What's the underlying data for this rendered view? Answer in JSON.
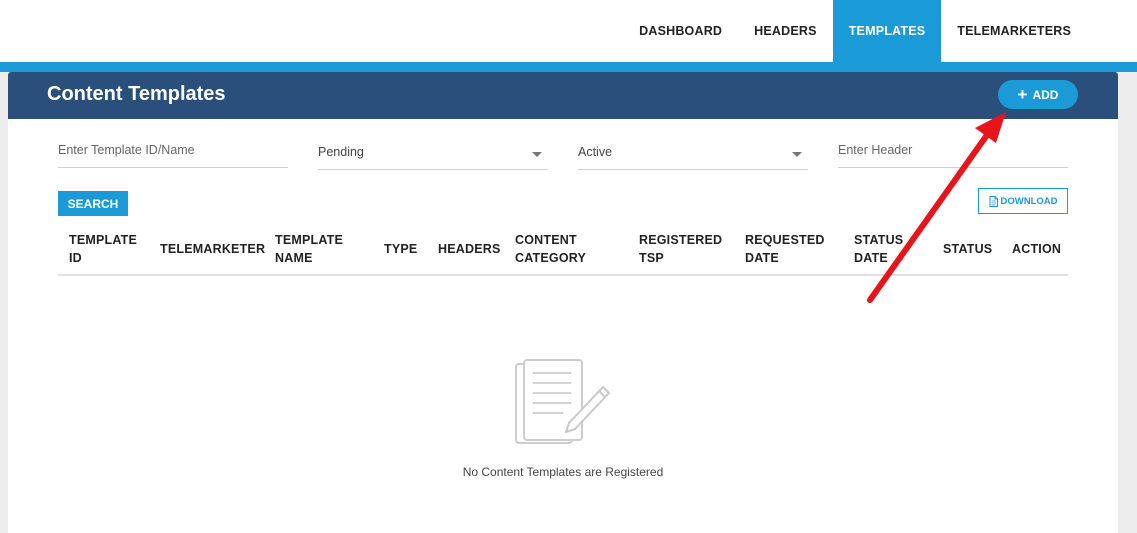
{
  "nav": {
    "items": [
      {
        "label": "DASHBOARD",
        "active": false
      },
      {
        "label": "HEADERS",
        "active": false
      },
      {
        "label": "TEMPLATES",
        "active": true
      },
      {
        "label": "TELEMARKETERS",
        "active": false
      }
    ]
  },
  "card": {
    "title": "Content Templates",
    "add_label": "ADD"
  },
  "filters": {
    "template_id_placeholder": "Enter Template ID/Name",
    "status_value": "Pending",
    "state_value": "Active",
    "header_placeholder": "Enter Header"
  },
  "actions": {
    "search_label": "SEARCH",
    "download_label": "DOWNLOAD"
  },
  "table": {
    "columns": [
      [
        "TEMPLATE",
        "ID"
      ],
      [
        "TELEMARKETER"
      ],
      [
        "TEMPLATE",
        "NAME"
      ],
      [
        "TYPE"
      ],
      [
        "HEADERS"
      ],
      [
        "CONTENT",
        "CATEGORY"
      ],
      [
        "REGISTERED",
        "TSP"
      ],
      [
        "REQUESTED",
        "DATE"
      ],
      [
        "STATUS",
        "DATE"
      ],
      [
        "STATUS"
      ],
      [
        "ACTION"
      ]
    ]
  },
  "empty_state": {
    "message": "No Content Templates are Registered",
    "icon": "document-pencil-icon"
  },
  "colors": {
    "accent": "#1a9ad6",
    "header_bg": "#2a4f7b",
    "annotation": "#e8141b"
  }
}
